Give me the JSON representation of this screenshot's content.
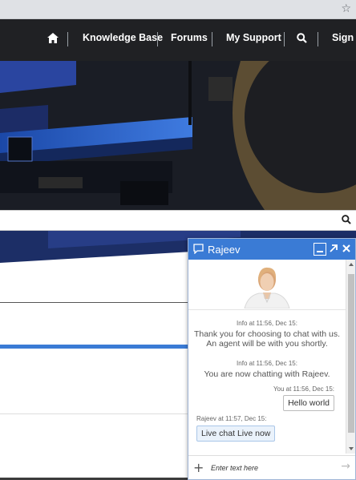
{
  "browser": {
    "bookmark_icon": "star-icon"
  },
  "nav": {
    "home_icon": "home-icon",
    "items": [
      "Knowledge Base",
      "Forums",
      "My Support"
    ],
    "search_icon": "search-icon",
    "signin": "Sign In"
  },
  "search": {
    "icon": "search-icon"
  },
  "colors": {
    "accent": "#3a7bd5",
    "nav_bg": "#202124"
  },
  "chat": {
    "agent_name": "Rajeev",
    "header_icon": "chat-bubble-icon",
    "messages": {
      "m1_meta": "Info at 11:56, Dec 15:",
      "m1_text": "Thank you for choosing to chat with us. An agent will be with you shortly.",
      "m2_meta": "Info at 11:56, Dec 15:",
      "m2_text": "You are now chatting with Rajeev.",
      "m3_meta": "You at 11:56, Dec 15:",
      "m3_text": "Hello world",
      "m4_meta": "Rajeev at 11:57, Dec 15:",
      "m4_text": "Live chat Live now"
    },
    "composer": {
      "placeholder": "Enter text here"
    }
  }
}
